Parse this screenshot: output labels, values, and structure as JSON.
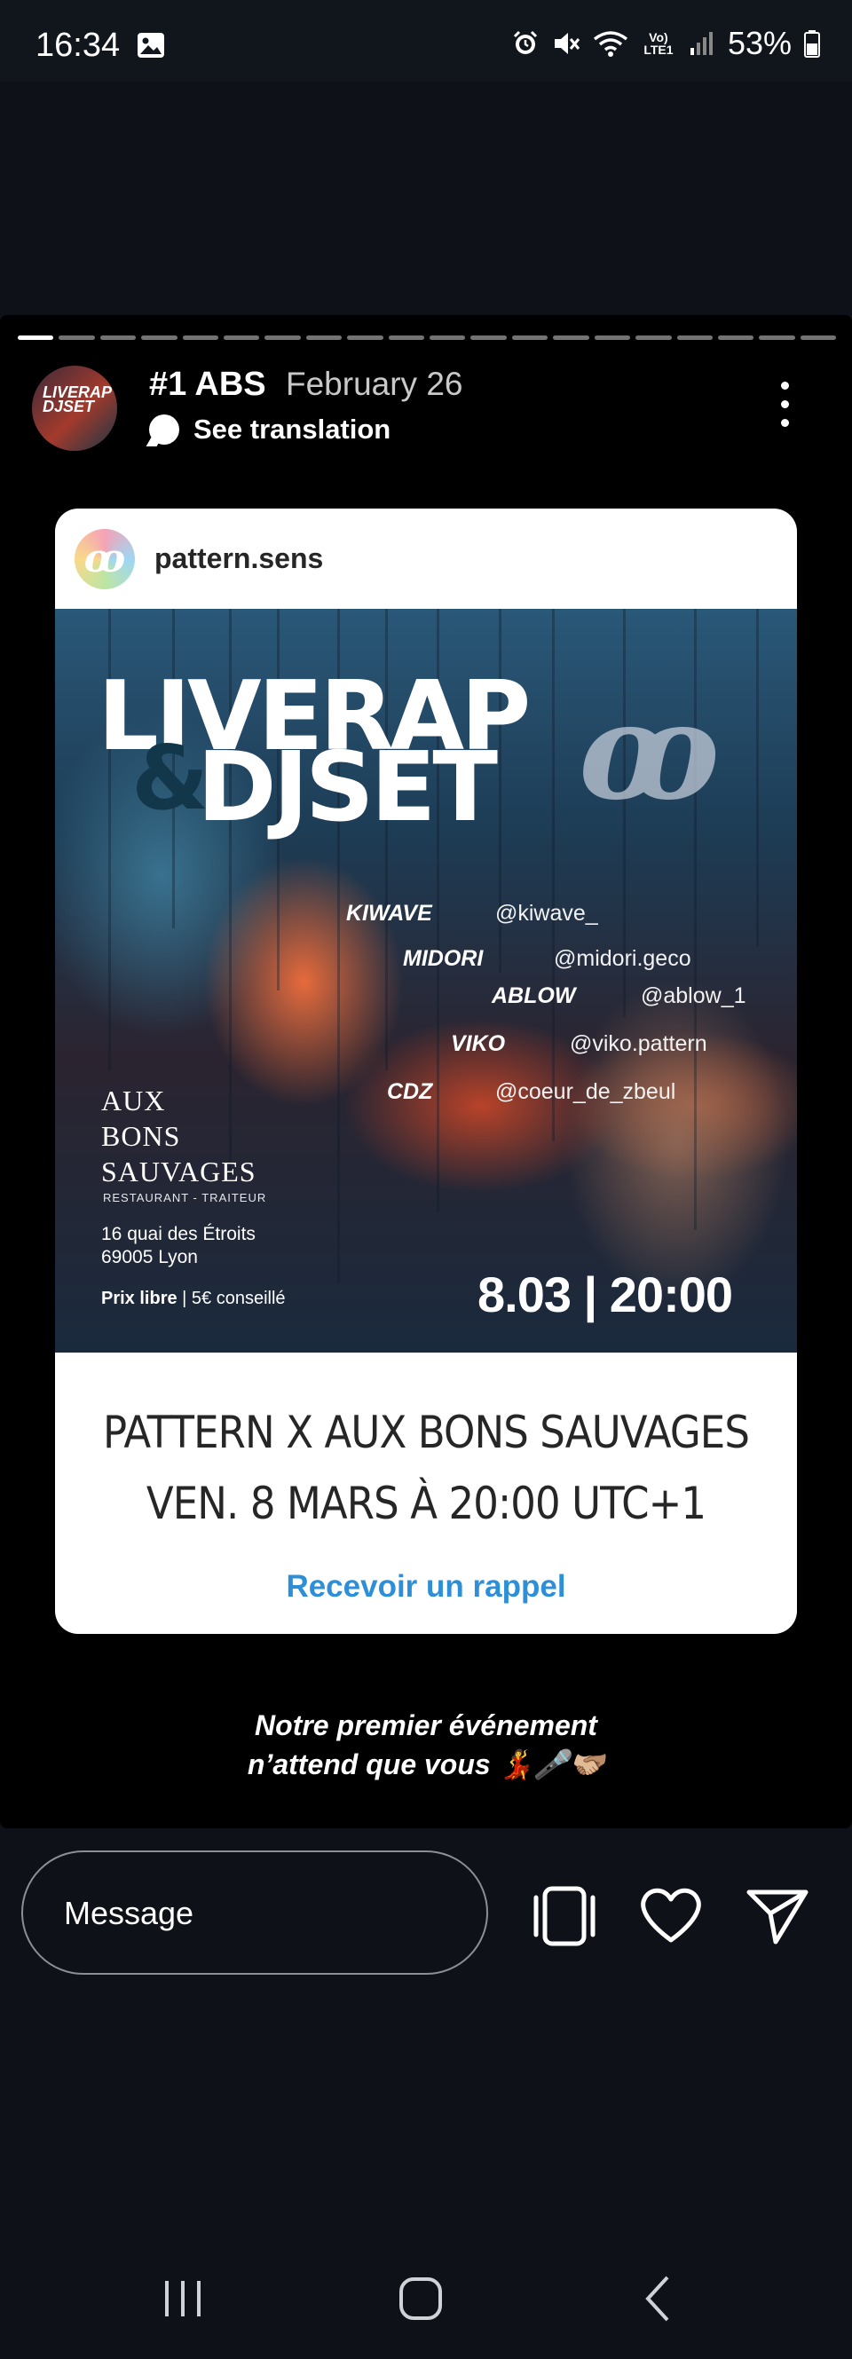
{
  "status_bar": {
    "time": "16:34",
    "network": "Vo) LTE1",
    "battery": "53%",
    "icons": [
      "gallery-icon",
      "alarm-icon",
      "mute-icon",
      "wifi-icon",
      "signal-icon",
      "battery-icon"
    ]
  },
  "story": {
    "author": "#1 ABS",
    "date": "February 26",
    "translate_label": "See translation",
    "shared_post": {
      "username": "pattern.sens",
      "poster": {
        "title_line1": "LIVERAP",
        "title_amp": "&",
        "title_line2": "DJSET",
        "lineup": [
          {
            "name": "KIWAVE",
            "handle": "@kiwave_"
          },
          {
            "name": "MIDORI",
            "handle": "@midori.geco"
          },
          {
            "name": "ABLOW",
            "handle": "@ablow_1"
          },
          {
            "name": "VIKO",
            "handle": "@viko.pattern"
          },
          {
            "name": "CDZ",
            "handle": "@coeur_de_zbeul"
          }
        ],
        "venue_line1": "AUX",
        "venue_line2": "BONS",
        "venue_line3": "SAUVAGES",
        "venue_sub": "RESTAURANT - TRAITEUR",
        "address_line1": "16 quai des Étroits",
        "address_line2": "69005 Lyon",
        "price_bold": "Prix libre",
        "price_rest": " | 5€ conseillé",
        "datetime": "8.03 | 20:00"
      },
      "event_title": "PATTERN X AUX BONS SAUVAGES",
      "event_date": "VEN. 8 MARS À 20:00 UTC+1",
      "reminder_label": "Recevoir un rappel"
    },
    "caption_line1": "Notre premier événement",
    "caption_line2": "n’attend que vous 💃🎤🫱🏼‍🫲🏽"
  },
  "reply_bar": {
    "placeholder": "Message"
  },
  "colors": {
    "background": "#0e1117",
    "story_bg": "#000000",
    "link_blue": "#2d8fd8"
  }
}
